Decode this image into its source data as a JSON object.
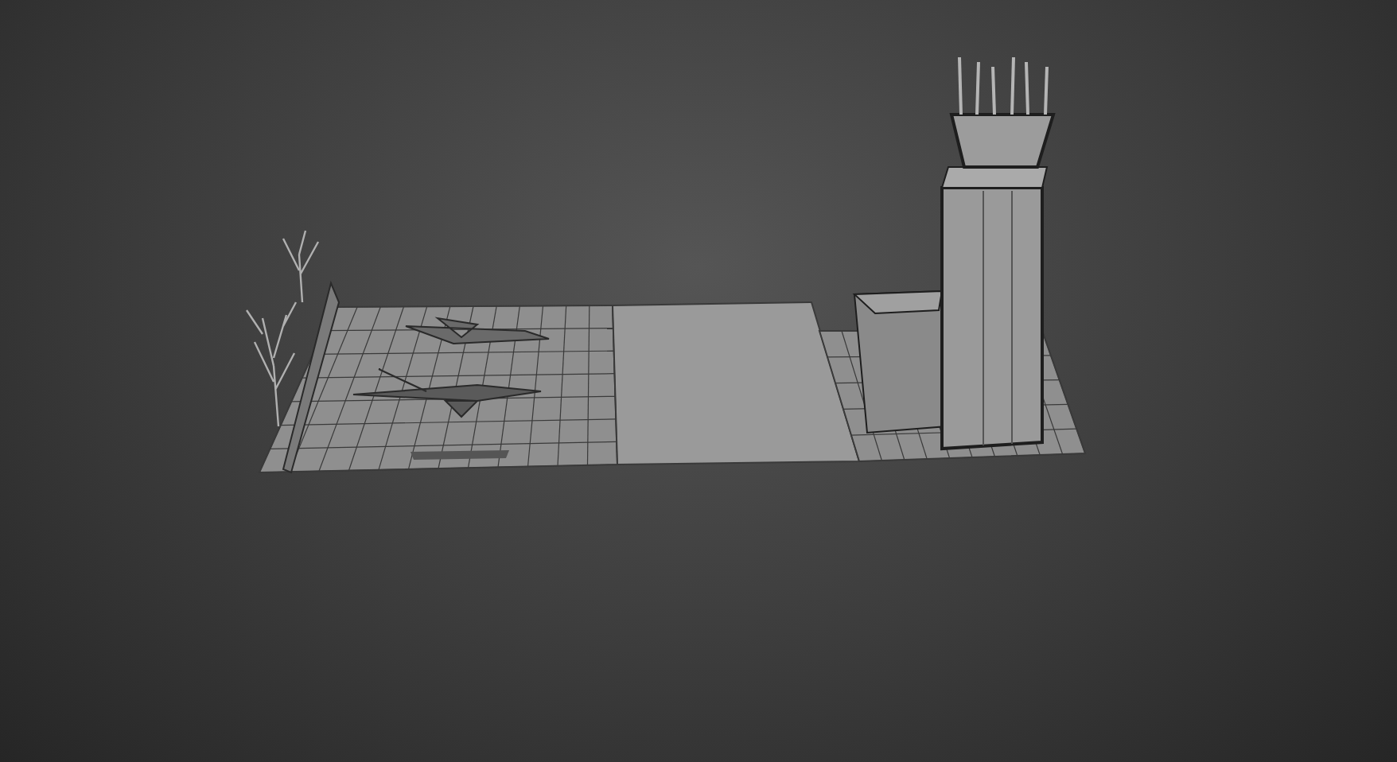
{
  "viewport": {
    "kind": "shaded"
  }
}
